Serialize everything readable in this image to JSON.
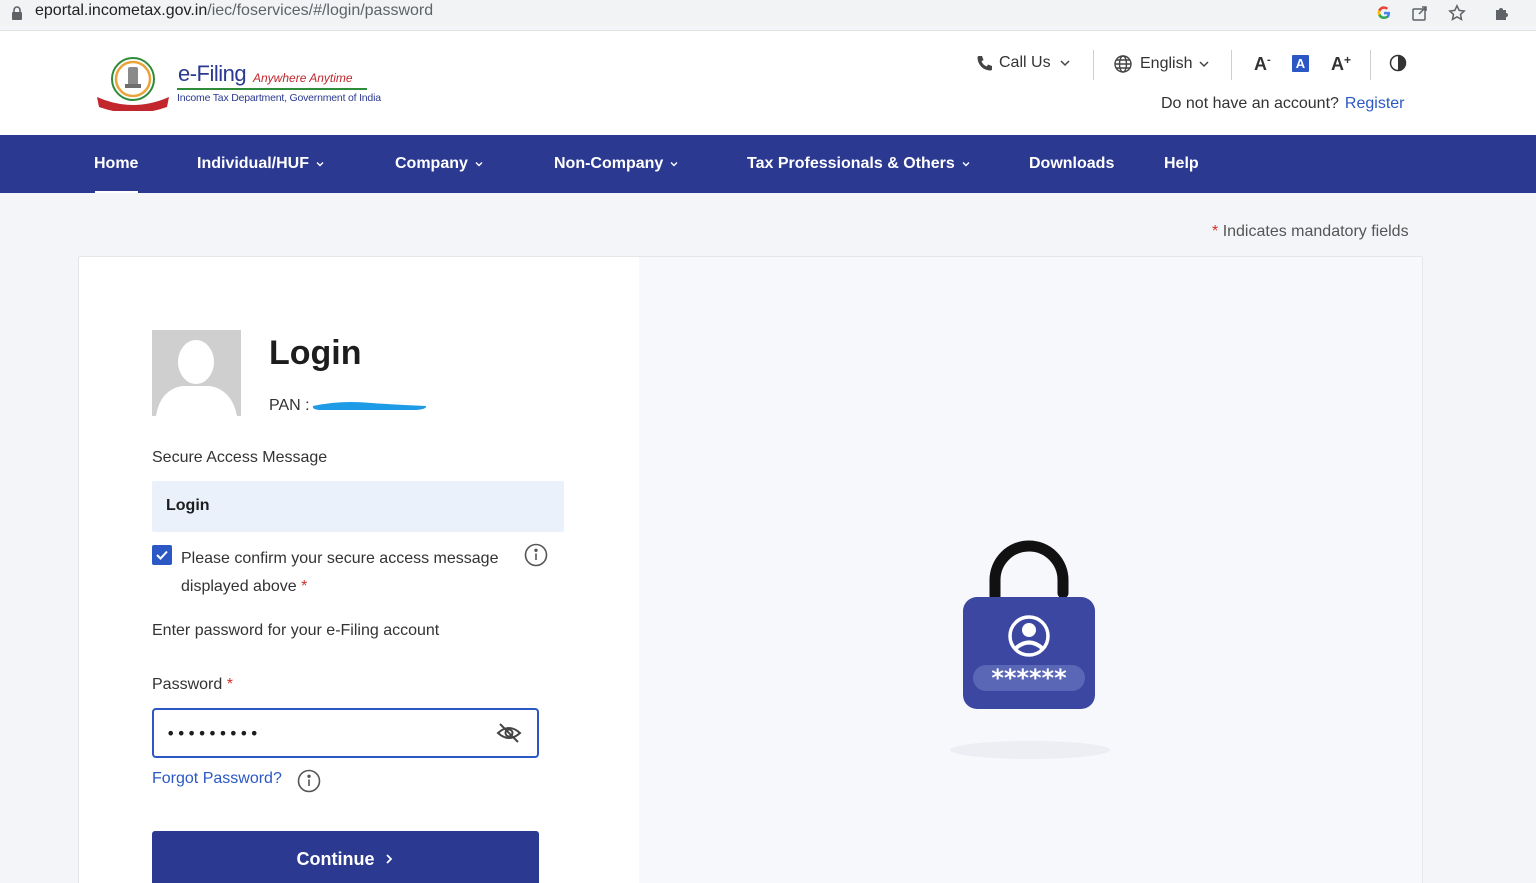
{
  "browser": {
    "url_domain": "eportal.incometax.gov.in",
    "url_path": "/iec/foservices/#/login/password",
    "icons": [
      "lock-icon",
      "google-icon",
      "share-icon",
      "star-icon",
      "extensions-icon"
    ]
  },
  "brand": {
    "title": "e-Filing",
    "tagline": "Anywhere Anytime",
    "subtitle": "Income Tax Department, Government of India",
    "emblem_ribbon": "INCOME TAX DEPARTMENT"
  },
  "header": {
    "call_us": "Call Us",
    "language": "English",
    "font_decrease": "A",
    "font_reset": "A",
    "font_increase": "A",
    "account_prompt": "Do not have an account?",
    "register": "Register"
  },
  "nav": {
    "items": [
      {
        "label": "Home",
        "dropdown": false,
        "active": true
      },
      {
        "label": "Individual/HUF",
        "dropdown": true
      },
      {
        "label": "Company",
        "dropdown": true
      },
      {
        "label": "Non-Company",
        "dropdown": true
      },
      {
        "label": "Tax Professionals & Others",
        "dropdown": true
      },
      {
        "label": "Downloads",
        "dropdown": false
      },
      {
        "label": "Help",
        "dropdown": false
      }
    ]
  },
  "form": {
    "mandatory_star": "*",
    "mandatory_note": "Indicates mandatory fields",
    "title": "Login",
    "pan_label": "PAN :",
    "secure_access_label": "Secure Access Message",
    "secure_access_value": "Login",
    "confirm_text": "Please confirm your secure access message displayed above",
    "confirm_checked": true,
    "enter_password_text": "Enter password for your e-Filing account",
    "password_label": "Password",
    "password_value": "•••••••••",
    "forgot_password": "Forgot Password?",
    "continue": "Continue"
  },
  "illustration": {
    "mask_text": "******"
  },
  "colors": {
    "primary": "#2b3990",
    "link": "#2b58c4",
    "required": "#d32f2f",
    "panel": "#f7f8fb",
    "message_box": "#eaf1fb"
  }
}
